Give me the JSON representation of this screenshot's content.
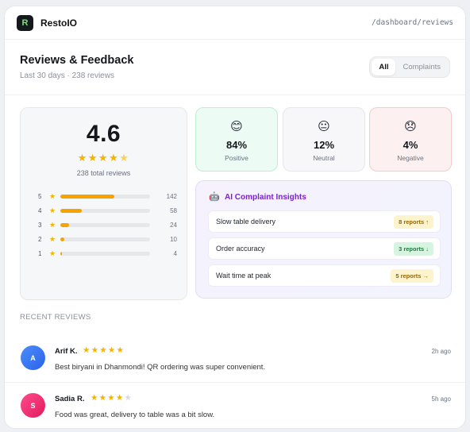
{
  "app": {
    "logo_letter": "R",
    "name": "RestoIO",
    "path": "/dashboard/reviews"
  },
  "header": {
    "title": "Reviews & Feedback",
    "subtitle": "Last 30 days · 238 reviews",
    "filters": [
      {
        "label": "All",
        "active": true
      },
      {
        "label": "Complaints",
        "active": false
      }
    ]
  },
  "rating": {
    "average": "4.6",
    "stars": 4.5,
    "total_text": "238 total reviews",
    "distribution": [
      {
        "stars": "5",
        "count": "142",
        "fraction": 0.6
      },
      {
        "stars": "4",
        "count": "58",
        "fraction": 0.24
      },
      {
        "stars": "3",
        "count": "24",
        "fraction": 0.1
      },
      {
        "stars": "2",
        "count": "10",
        "fraction": 0.04
      },
      {
        "stars": "1",
        "count": "4",
        "fraction": 0.02
      }
    ]
  },
  "sentiment": [
    {
      "emoji": "😊",
      "pct": "84%",
      "label": "Positive"
    },
    {
      "emoji": "😐",
      "pct": "12%",
      "label": "Neutral"
    },
    {
      "emoji": "😞",
      "pct": "4%",
      "label": "Negative"
    }
  ],
  "insights": {
    "icon": "robot-icon",
    "title": "AI Complaint Insights",
    "items": [
      {
        "label": "Slow table delivery",
        "badge": "8 reports ↑",
        "trend": "up"
      },
      {
        "label": "Order accuracy",
        "badge": "3 reports ↓",
        "trend": "down"
      },
      {
        "label": "Wait time at peak",
        "badge": "5 reports →",
        "trend": "flat"
      }
    ]
  },
  "recent": {
    "title": "RECENT REVIEWS",
    "reviews": [
      {
        "initial": "A",
        "name": "Arif K.",
        "rating": 5,
        "time": "2h ago",
        "text": "Best biryani in Dhanmondi! QR ordering was super convenient."
      },
      {
        "initial": "S",
        "name": "Sadia R.",
        "rating": 4,
        "time": "5h ago",
        "text": "Food was great, delivery to table was a bit slow."
      }
    ]
  },
  "colors": {
    "accent": "#7b22d0",
    "star": "#f5b301",
    "bar": "#f5a300",
    "positive_bg": "#ecfbf3",
    "negative_bg": "#fdf0f0"
  }
}
